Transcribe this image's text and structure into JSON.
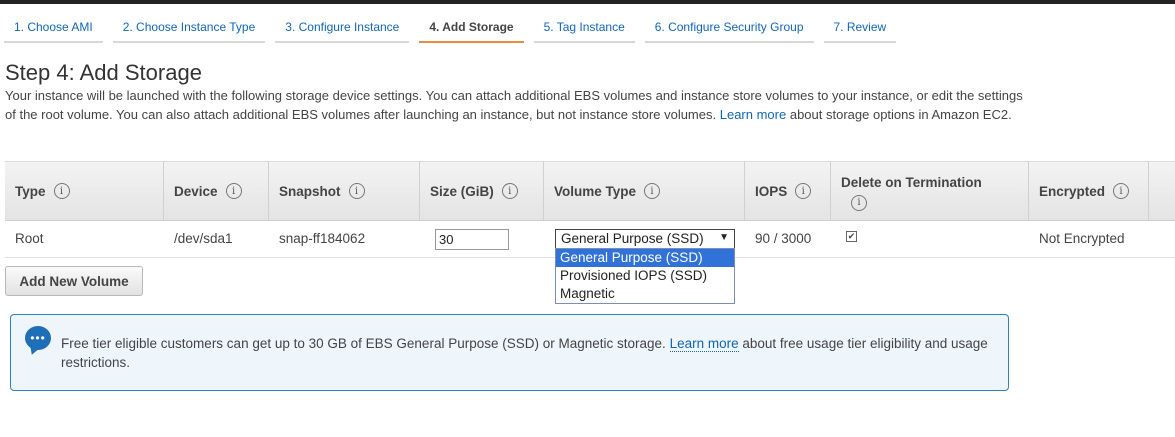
{
  "wizard": {
    "tabs": [
      {
        "label": "1. Choose AMI"
      },
      {
        "label": "2. Choose Instance Type"
      },
      {
        "label": "3. Configure Instance"
      },
      {
        "label": "4. Add Storage",
        "active": true
      },
      {
        "label": "5. Tag Instance"
      },
      {
        "label": "6. Configure Security Group"
      },
      {
        "label": "7. Review"
      }
    ]
  },
  "page": {
    "title": "Step 4: Add Storage",
    "description_part1": "Your instance will be launched with the following storage device settings. You can attach additional EBS volumes and instance store volumes to your instance, or edit the settings of the root volume. You can also attach additional EBS volumes after launching an instance, but not instance store volumes.",
    "learn_more": "Learn more",
    "description_part2": "about storage options in Amazon EC2."
  },
  "table": {
    "headers": {
      "type": "Type",
      "device": "Device",
      "snapshot": "Snapshot",
      "size": "Size (GiB)",
      "volume_type": "Volume Type",
      "iops": "IOPS",
      "delete_on_termination": "Delete on Termination",
      "encrypted": "Encrypted"
    },
    "info_glyph": "i",
    "rows": [
      {
        "type": "Root",
        "device": "/dev/sda1",
        "snapshot": "snap-ff184062",
        "size": "30",
        "volume_type": "General Purpose (SSD)",
        "iops": "90 / 3000",
        "delete_on_termination": true,
        "encrypted": "Not Encrypted"
      }
    ]
  },
  "volume_type_dropdown": {
    "arrow": "▼",
    "options": [
      "General Purpose (SSD)",
      "Provisioned IOPS (SSD)",
      "Magnetic"
    ],
    "highlighted": "General Purpose (SSD)"
  },
  "add_volume_button": "Add New Volume",
  "notice": {
    "icon": "speech-bubble-icon",
    "icon_glyph": "•••",
    "text_part1": "Free tier eligible customers can get up to 30 GB of EBS General Purpose (SSD) or Magnetic storage.",
    "link": "Learn more",
    "text_part2": "about free usage tier eligibility and usage restrictions."
  },
  "colors": {
    "link": "#1166bb",
    "active_tab_underline": "#e98d3c",
    "selection": "#3072d8",
    "notice_border": "#2d82c4"
  }
}
